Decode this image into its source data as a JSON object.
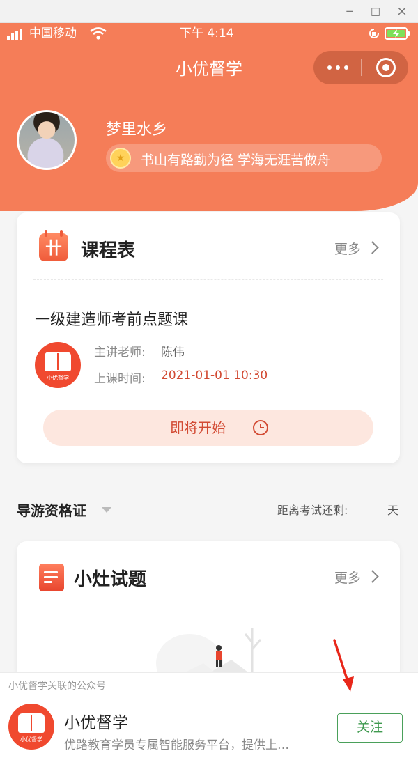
{
  "window": {
    "minimize": "−",
    "maximize": "□",
    "close": "×"
  },
  "status_bar": {
    "carrier": "中国移动",
    "time": "下午 4:14"
  },
  "nav": {
    "title": "小优督学"
  },
  "profile": {
    "name": "梦里水乡",
    "motto": "书山有路勤为径 学海无涯苦做舟"
  },
  "schedule_card": {
    "title": "课程表",
    "more_label": "更多",
    "course": {
      "name": "一级建造师考前点题课",
      "teacher_label": "主讲老师:",
      "teacher": "陈伟",
      "time_label": "上课时间:",
      "time": "2021-01-01 10:30",
      "button_label": "即将开始",
      "logo_caption": "小优督学"
    }
  },
  "exam_bar": {
    "selected_exam": "导游资格证",
    "remaining_label": "距离考试还剩:",
    "day_unit": "天"
  },
  "quiz_card": {
    "title": "小灶试题",
    "more_label": "更多"
  },
  "follow_panel": {
    "label": "小优督学关联的公众号",
    "account_name": "小优督学",
    "description": "优路教育学员专属智能服务平台，提供上…",
    "follow_button": "关注",
    "logo_caption": "小优督学"
  },
  "colors": {
    "brand": "#f57d58",
    "accent_red": "#d24a33",
    "follow_green": "#4aa05a",
    "arrow_red": "#e8271a"
  }
}
